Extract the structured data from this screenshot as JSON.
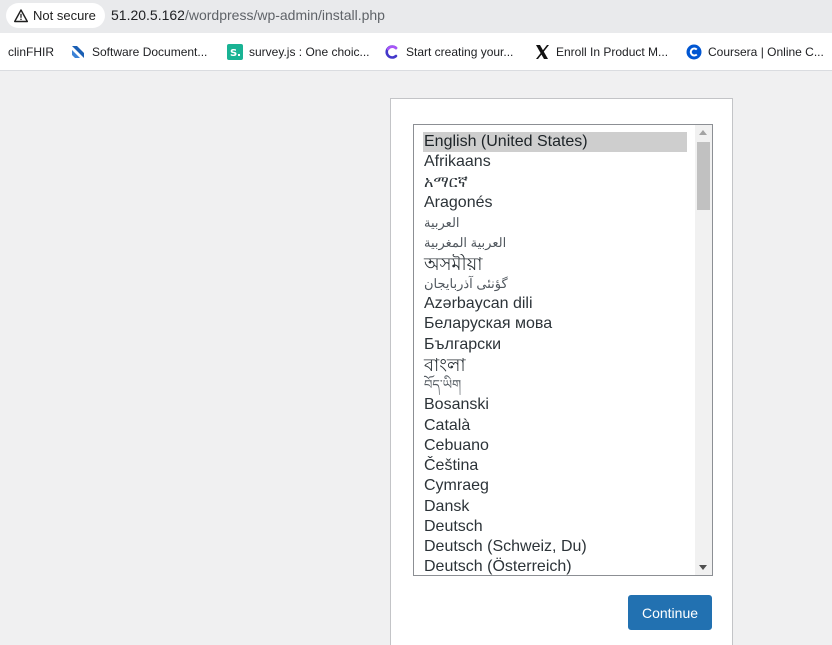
{
  "browser": {
    "security_label": "Not secure",
    "url_host": "51.20.5.162",
    "url_path": "/wordpress/wp-admin/install.php"
  },
  "bookmarks": [
    {
      "label": "clinFHIR",
      "icon": "none"
    },
    {
      "label": "Software Document...",
      "icon": "blue-ribbon-icon"
    },
    {
      "label": "survey.js : One choic...",
      "icon": "surveyjs-icon"
    },
    {
      "label": "Start creating your...",
      "icon": "c-swirl-icon"
    },
    {
      "label": "Enroll In Product M...",
      "icon": "x-logo-icon"
    },
    {
      "label": "Coursera | Online C...",
      "icon": "coursera-icon"
    }
  ],
  "language_select": {
    "selected": "English (United States)",
    "options": [
      "English (United States)",
      "Afrikaans",
      "አማርኛ",
      "Aragonés",
      "العربية",
      "العربية المغربية",
      "অসমীয়া",
      "گؤنئی آذربایجان",
      "Azərbaycan dili",
      "Беларуская мова",
      "Български",
      "বাংলা",
      "བོད་ཡིག",
      "Bosanski",
      "Català",
      "Cebuano",
      "Čeština",
      "Cymraeg",
      "Dansk",
      "Deutsch",
      "Deutsch (Schweiz, Du)",
      "Deutsch (Österreich)"
    ]
  },
  "continue_label": "Continue",
  "colors": {
    "button": "#2271b1",
    "selected_option_bg": "#cecece",
    "page_bg": "#f0f0f1"
  }
}
